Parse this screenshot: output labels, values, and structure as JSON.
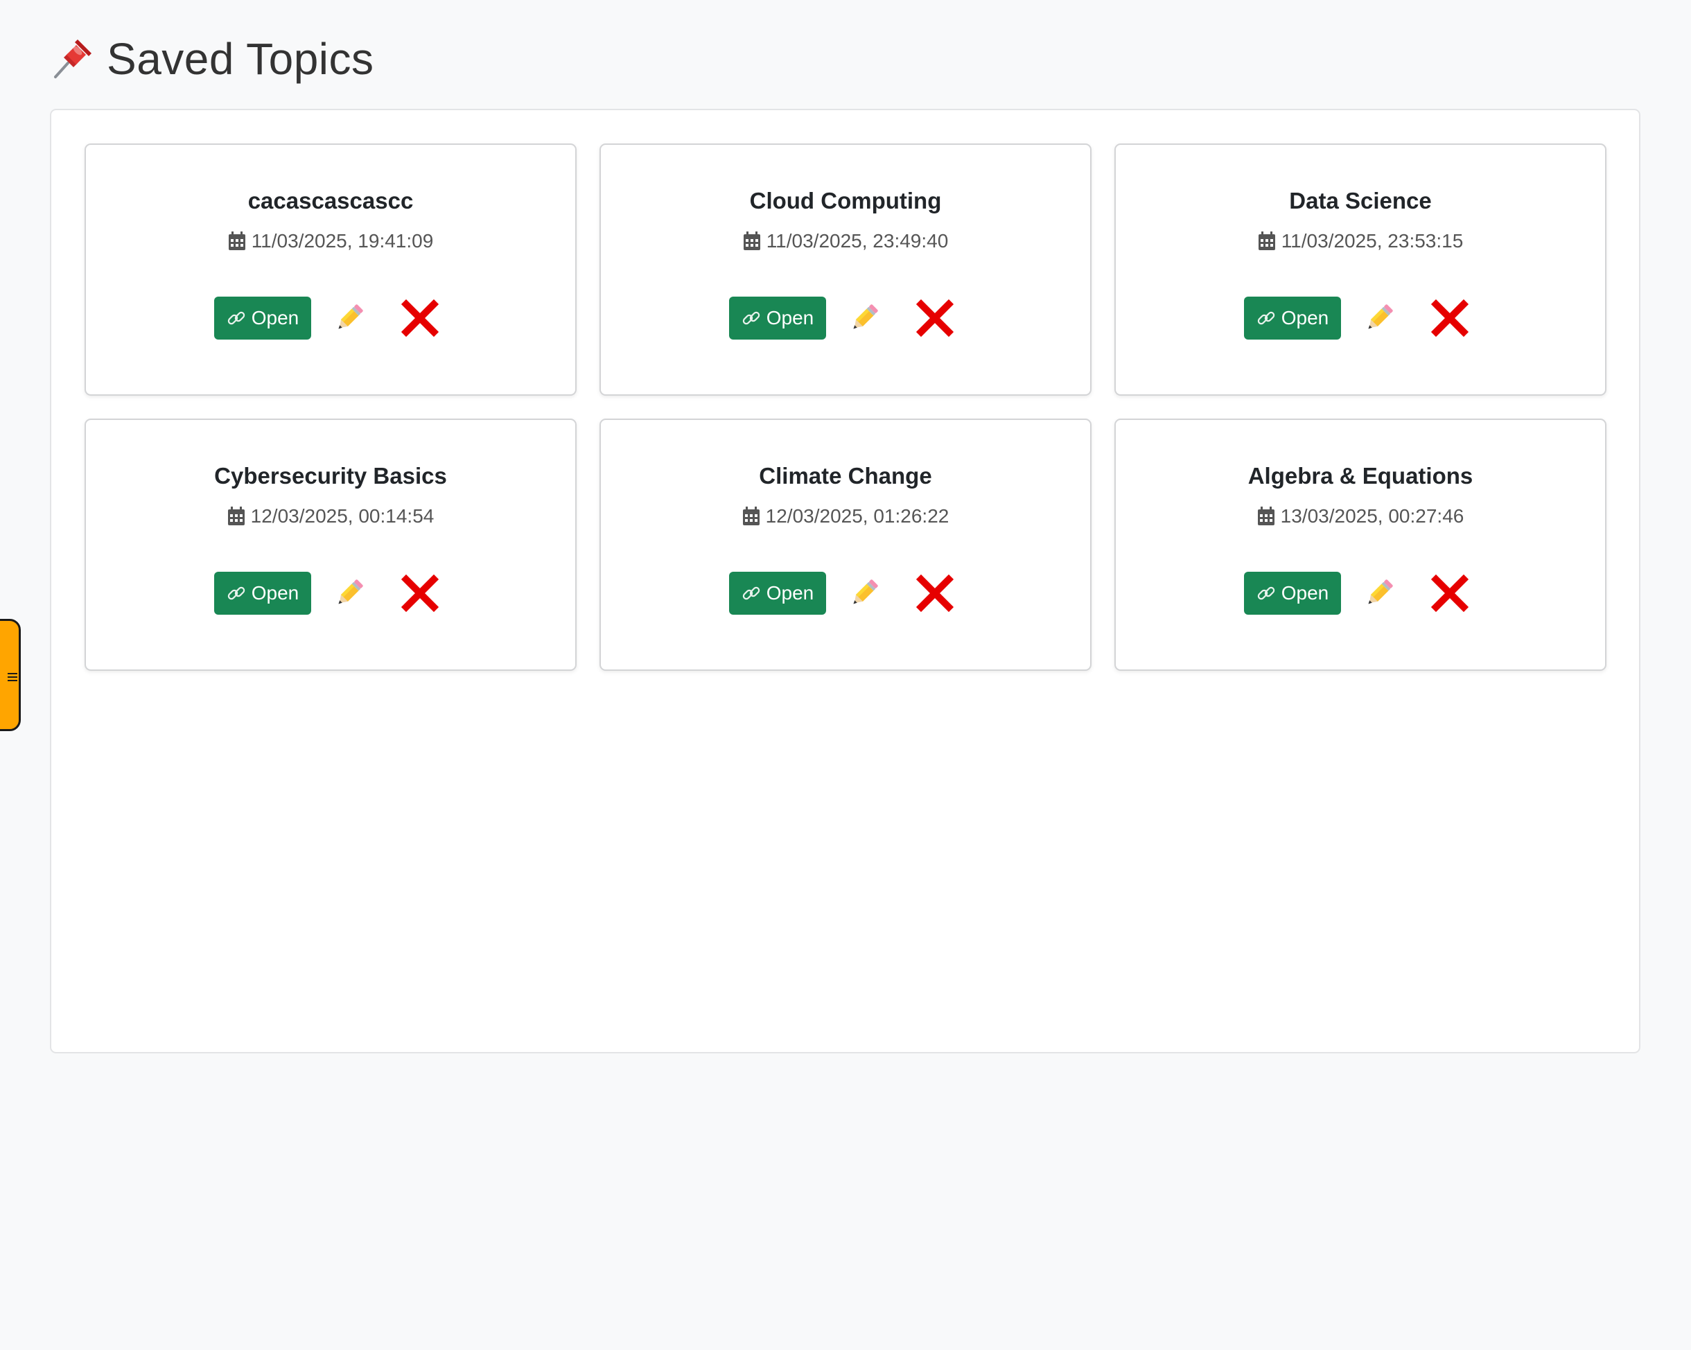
{
  "header": {
    "title": "Saved Topics",
    "icon": "pushpin-icon"
  },
  "topics": [
    {
      "title": "cacascascascc",
      "date": "11/03/2025, 19:41:09",
      "open_label": "Open"
    },
    {
      "title": "Cloud Computing",
      "date": "11/03/2025, 23:49:40",
      "open_label": "Open"
    },
    {
      "title": "Data Science",
      "date": "11/03/2025, 23:53:15",
      "open_label": "Open"
    },
    {
      "title": "Cybersecurity Basics",
      "date": "12/03/2025, 00:14:54",
      "open_label": "Open"
    },
    {
      "title": "Climate Change",
      "date": "12/03/2025, 01:26:22",
      "open_label": "Open"
    },
    {
      "title": "Algebra & Equations",
      "date": "13/03/2025, 00:27:46",
      "open_label": "Open"
    }
  ],
  "icons": {
    "date": "calendar-icon",
    "open": "link-icon",
    "edit": "pencil-icon",
    "delete": "cross-mark-icon",
    "sidebar_toggle": "menu-icon"
  },
  "colors": {
    "open_button": "#198754",
    "delete": "#e60000",
    "sidebar_toggle": "#ffa500",
    "background": "#f8f9fa"
  }
}
